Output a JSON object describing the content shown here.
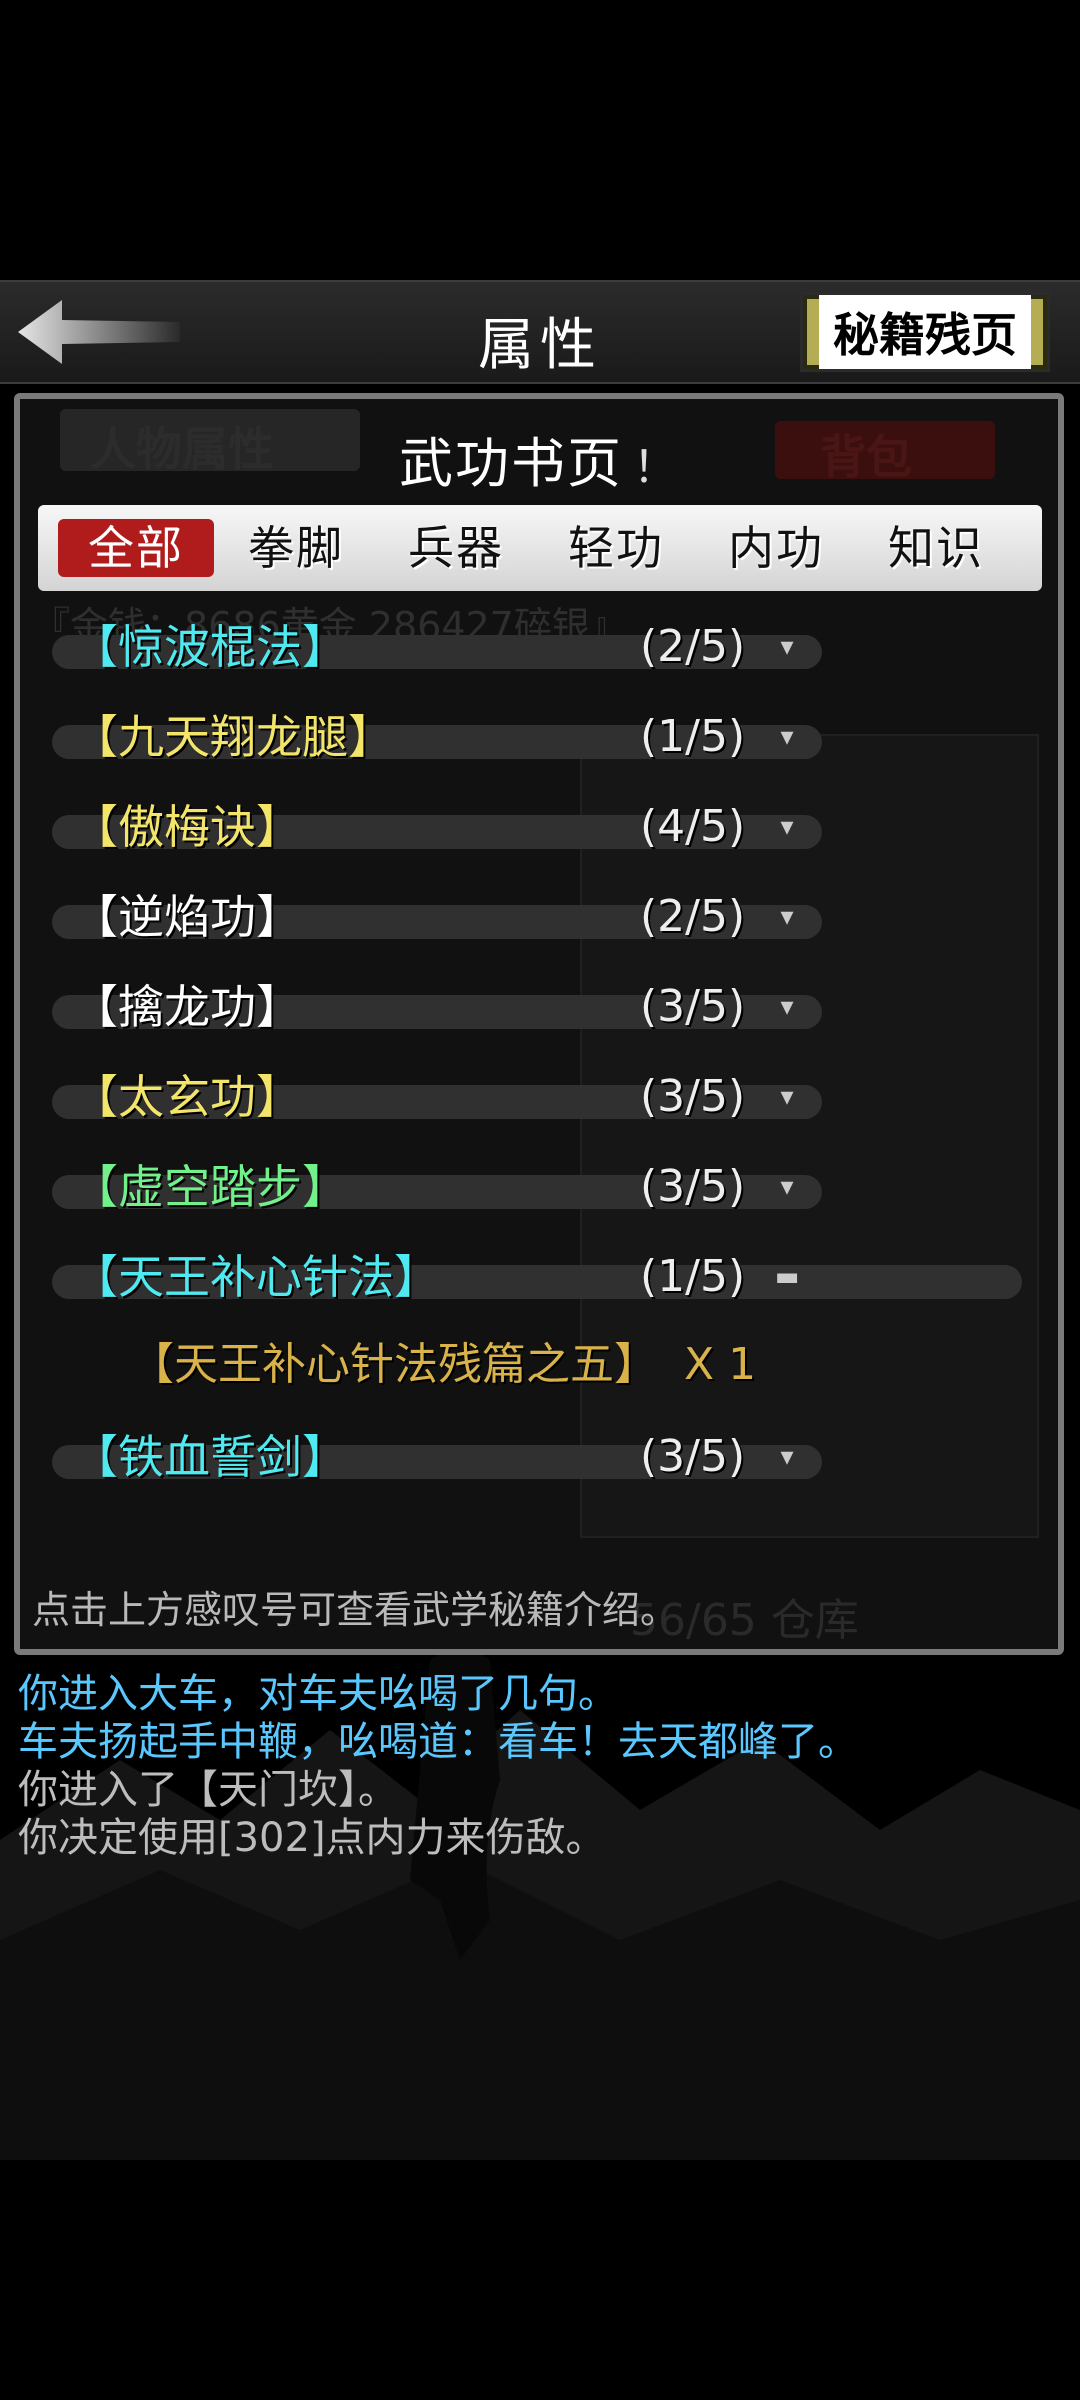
{
  "header": {
    "title": "属性",
    "fragment_button": "秘籍残页"
  },
  "background": {
    "tab_attributes": "人物属性",
    "tab_bag": "背包",
    "gold_line": "『金钱：8686黄金 286427碎银』",
    "storage": "56/65 仓库"
  },
  "dialog": {
    "title": "武功书页",
    "info_mark": "！",
    "categories": [
      "全部",
      "拳脚",
      "兵器",
      "轻功",
      "内功",
      "知识"
    ],
    "active_category": "全部",
    "items": [
      {
        "name": "【惊波棍法】",
        "count": "(2/5)",
        "color": "#4fe9f0",
        "expanded": false
      },
      {
        "name": "【九天翔龙腿】",
        "count": "(1/5)",
        "color": "#f2e56a",
        "expanded": false
      },
      {
        "name": "【傲梅诀】",
        "count": "(4/5)",
        "color": "#f2e56a",
        "expanded": false
      },
      {
        "name": "【逆焰功】",
        "count": "(2/5)",
        "color": "#ffffff",
        "expanded": false
      },
      {
        "name": "【擒龙功】",
        "count": "(3/5)",
        "color": "#ffffff",
        "expanded": false
      },
      {
        "name": "【太玄功】",
        "count": "(3/5)",
        "color": "#f2e56a",
        "expanded": false
      },
      {
        "name": "【虚空踏步】",
        "count": "(3/5)",
        "color": "#72f08a",
        "expanded": false
      },
      {
        "name": "【天王补心针法】",
        "count": "(1/5)",
        "color": "#4fe9f0",
        "expanded": true
      },
      {
        "name": "【铁血誓剑】",
        "count": "(3/5)",
        "color": "#4fe9f0",
        "expanded": false
      }
    ],
    "sub_item": {
      "name": "【天王补心针法残篇之五】",
      "qty": "X 1"
    },
    "hint": "点击上方感叹号可查看武学秘籍介绍。"
  },
  "log": [
    {
      "text": "你进入大车，对车夫吆喝了几句。",
      "color": "#5ac8ff"
    },
    {
      "text": "车夫扬起手中鞭，吆喝道：看车！去天都峰了。",
      "color": "#5ac8ff"
    },
    {
      "text": "你进入了【天门坎】。",
      "color": "#bdbdbd"
    },
    {
      "text": "你决定使用[302]点内力来伤敌。",
      "color": "#bdbdbd"
    }
  ]
}
